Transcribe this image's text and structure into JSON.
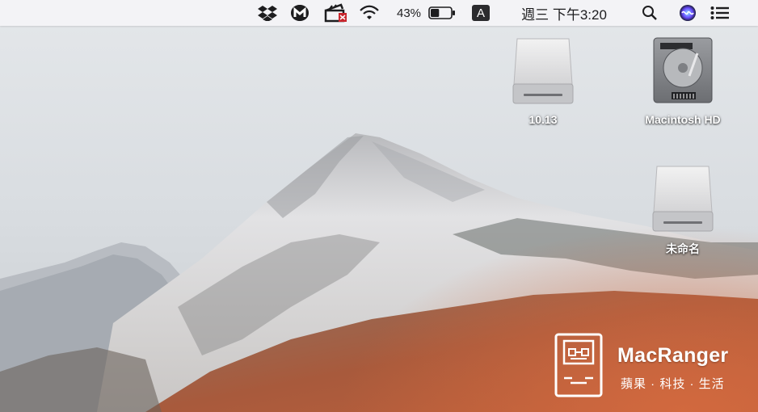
{
  "menubar": {
    "icons": [
      "dropbox-icon",
      "malwarebytes-icon",
      "clapper-app-icon",
      "wifi-icon",
      "battery-icon",
      "input-source-icon",
      "spotlight-icon",
      "siri-icon",
      "notification-center-icon"
    ],
    "battery_percent": "43%",
    "battery_level": 0.43,
    "input_source": "A",
    "clock": "週三 下午3:20"
  },
  "desktop": {
    "drives": [
      {
        "label": "10.13",
        "icon": "external-drive-icon"
      },
      {
        "label": "Macintosh HD",
        "icon": "internal-hard-drive-icon"
      },
      {
        "label": "未命名",
        "icon": "external-drive-icon"
      }
    ]
  },
  "watermark": {
    "brand": "MacRanger",
    "tagline": "蘋果 · 科技 · 生活",
    "icon": "macranger-logo-icon"
  },
  "wallpaper": {
    "sky": "#dfe3e7",
    "mountain_snow": "#e9e9ea",
    "hillside": "#a85a3c"
  }
}
